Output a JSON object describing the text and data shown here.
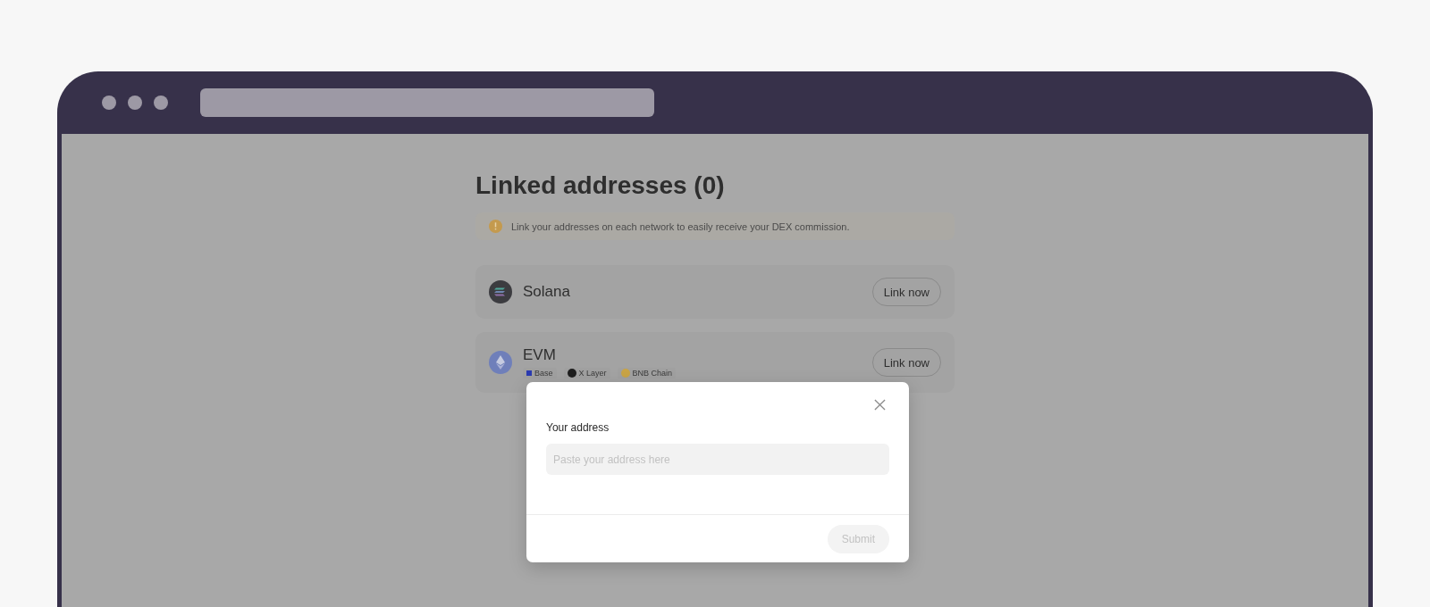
{
  "page": {
    "title": "Linked addresses (0)",
    "notice": "Link your addresses on each network to easily receive your DEX commission."
  },
  "networks": [
    {
      "name": "Solana",
      "kind": "solana",
      "button": "Link now"
    },
    {
      "name": "EVM",
      "kind": "evm",
      "button": "Link now",
      "chains": [
        {
          "name": "Base",
          "kind": "square",
          "color": "#2b3bb0"
        },
        {
          "name": "X Layer",
          "kind": "circle",
          "color": "#1e1e1e"
        },
        {
          "name": "BNB Chain",
          "kind": "circle",
          "color": "#c9a446"
        }
      ]
    }
  ],
  "dialog": {
    "label": "Your address",
    "placeholder": "Paste your address here",
    "submit": {
      "label": "Submit",
      "disabled": true
    }
  }
}
